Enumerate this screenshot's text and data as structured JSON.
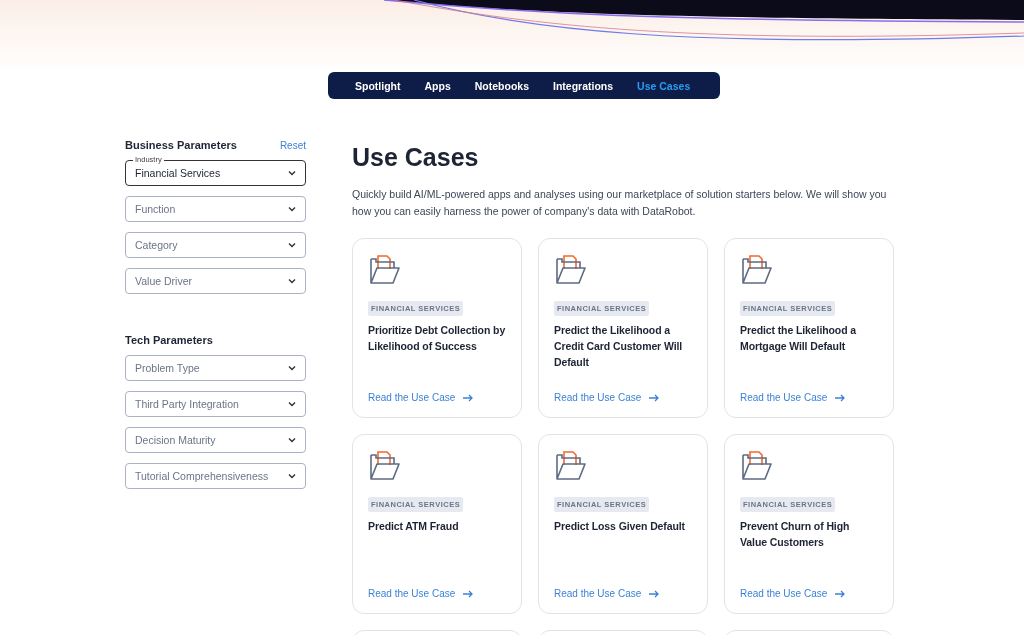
{
  "nav": [
    {
      "label": "Spotlight",
      "selected": false
    },
    {
      "label": "Apps",
      "selected": false
    },
    {
      "label": "Notebooks",
      "selected": false
    },
    {
      "label": "Integrations",
      "selected": false
    },
    {
      "label": "Use Cases",
      "selected": true
    }
  ],
  "sidebar": {
    "business": {
      "title": "Business Parameters",
      "reset": "Reset",
      "filters": [
        {
          "label": "Industry",
          "value": "Financial Services"
        },
        {
          "placeholder": "Function"
        },
        {
          "placeholder": "Category"
        },
        {
          "placeholder": "Value Driver"
        }
      ]
    },
    "tech": {
      "title": "Tech Parameters",
      "filters": [
        {
          "placeholder": "Problem Type"
        },
        {
          "placeholder": "Third Party Integration"
        },
        {
          "placeholder": "Decision Maturity"
        },
        {
          "placeholder": "Tutorial Comprehensiveness"
        }
      ]
    }
  },
  "main": {
    "title": "Use Cases",
    "intro": "Quickly build AI/ML-powered apps and analyses using our marketplace of solution starters below. We will show you how you can easily harness the power of company's data with DataRobot.",
    "cards": [
      {
        "kind": "full",
        "tag": "FINANCIAL SERVICES",
        "title": "Prioritize Debt Collection by Likelihood of Success",
        "link": "Read the Use Case"
      },
      {
        "kind": "full",
        "tag": "FINANCIAL SERVICES",
        "title": "Predict the Likelihood a Credit Card Customer Will Default",
        "link": "Read the Use Case"
      },
      {
        "kind": "full",
        "tag": "FINANCIAL SERVICES",
        "title": "Predict the Likelihood a Mortgage Will Default",
        "link": "Read the Use Case"
      },
      {
        "kind": "full",
        "tag": "FINANCIAL SERVICES",
        "title": "Predict ATM Fraud",
        "link": "Read the Use Case"
      },
      {
        "kind": "full",
        "tag": "FINANCIAL SERVICES",
        "title": "Predict Loss Given Default",
        "link": "Read the Use Case"
      },
      {
        "kind": "full",
        "tag": "FINANCIAL SERVICES",
        "title": "Prevent Churn of High Value Customers",
        "link": "Read the Use Case"
      },
      {
        "kind": "partial"
      },
      {
        "kind": "partial"
      },
      {
        "kind": "partial"
      }
    ]
  }
}
